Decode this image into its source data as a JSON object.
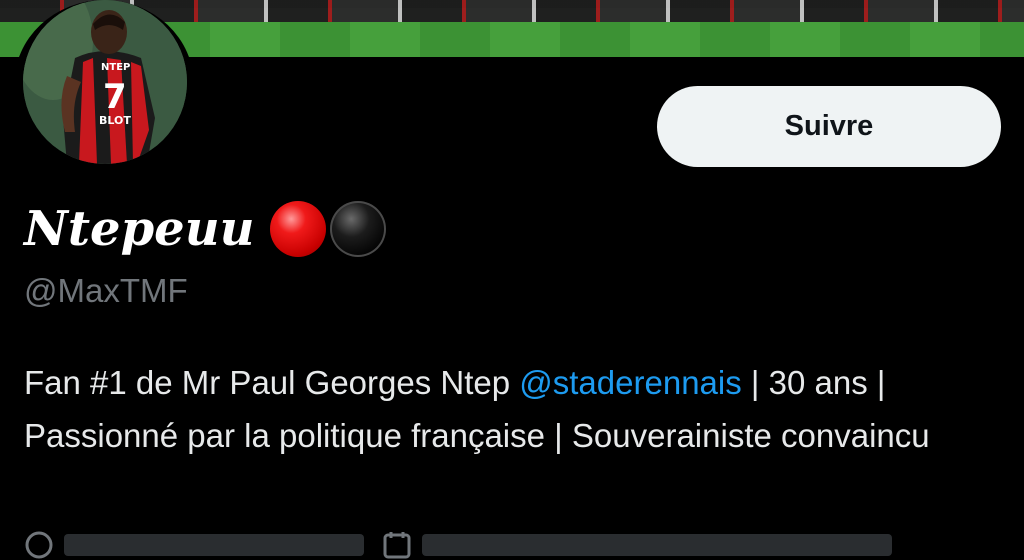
{
  "banner": {
    "description_icon": "stadium-banner"
  },
  "avatar": {
    "icon": "player-photo"
  },
  "follow_button": {
    "label": "Suivre"
  },
  "profile": {
    "display_name": "Ntepeuu",
    "name_emojis": [
      "red-circle-emoji",
      "black-circle-emoji"
    ],
    "handle": "@MaxTMF",
    "bio": {
      "part1": "Fan #1 de Mr Paul Georges Ntep ",
      "mention": "@staderennais",
      "part2": " | 30 ans | Passionné par la politique française | Souverainiste convaincu"
    }
  },
  "meta": {
    "location_icon": "location-icon",
    "calendar_icon": "calendar-icon"
  },
  "colors": {
    "background": "#000000",
    "button_bg": "#eff3f4",
    "mention": "#1d9bf0",
    "secondary_text": "#71767b"
  }
}
